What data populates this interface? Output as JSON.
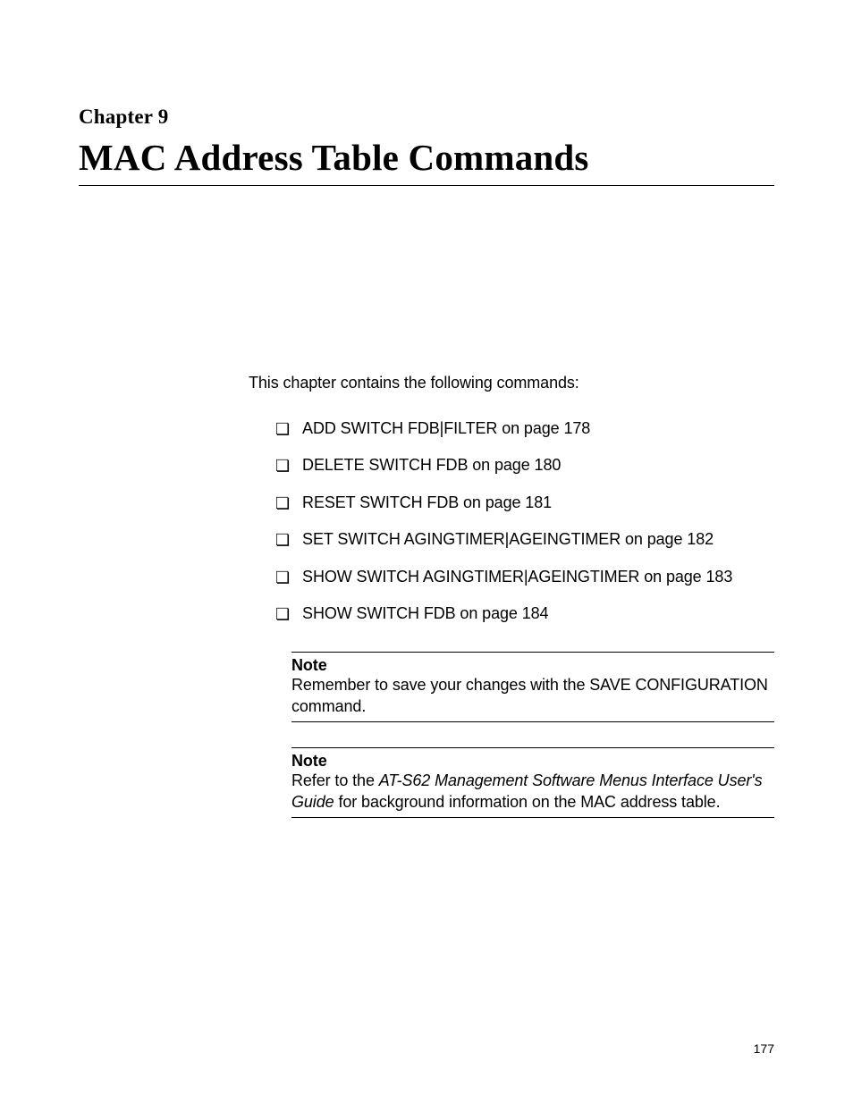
{
  "chapter": {
    "label": "Chapter 9",
    "title": "MAC Address Table Commands"
  },
  "intro": "This chapter contains the following commands:",
  "commands": [
    "ADD SWITCH FDB|FILTER on page 178",
    "DELETE SWITCH FDB on page 180",
    "RESET SWITCH FDB on page 181",
    "SET SWITCH AGINGTIMER|AGEINGTIMER on page 182",
    "SHOW SWITCH AGINGTIMER|AGEINGTIMER on page 183",
    "SHOW SWITCH FDB on page 184"
  ],
  "notes": [
    {
      "label": "Note",
      "body_parts": [
        {
          "text": "Remember to save your changes with the SAVE CONFIGURATION command.",
          "italic": false
        }
      ]
    },
    {
      "label": "Note",
      "body_parts": [
        {
          "text": "Refer to the ",
          "italic": false
        },
        {
          "text": "AT-S62 Management Software Menus Interface User's Guide",
          "italic": true
        },
        {
          "text": " for background information on the MAC address table.",
          "italic": false
        }
      ]
    }
  ],
  "page_number": "177",
  "bullet_glyph": "❏"
}
